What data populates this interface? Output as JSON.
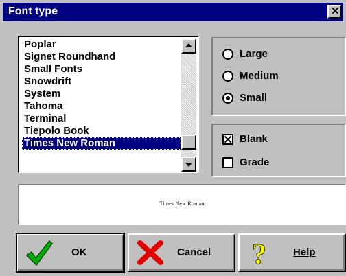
{
  "window": {
    "title": "Font type"
  },
  "fonts": {
    "items": [
      "Poplar",
      "Signet Roundhand",
      "Small Fonts",
      "Snowdrift",
      "System",
      "Tahoma",
      "Terminal",
      "Tiepolo Book",
      "Times New Roman"
    ],
    "selected": "Times New Roman"
  },
  "size": {
    "options": [
      {
        "label": "Large",
        "selected": false
      },
      {
        "label": "Medium",
        "selected": false
      },
      {
        "label": "Small",
        "selected": true
      }
    ]
  },
  "options": {
    "blank": {
      "label": "Blank",
      "checked": true
    },
    "grade": {
      "label": "Grade",
      "checked": false
    }
  },
  "preview": {
    "text": "Times New Roman"
  },
  "buttons": {
    "ok": "OK",
    "cancel": "Cancel",
    "help": "Help"
  },
  "icons": {
    "ok": "checkmark-icon",
    "cancel": "red-x-icon",
    "help": "question-mark-icon",
    "close": "close-icon"
  }
}
